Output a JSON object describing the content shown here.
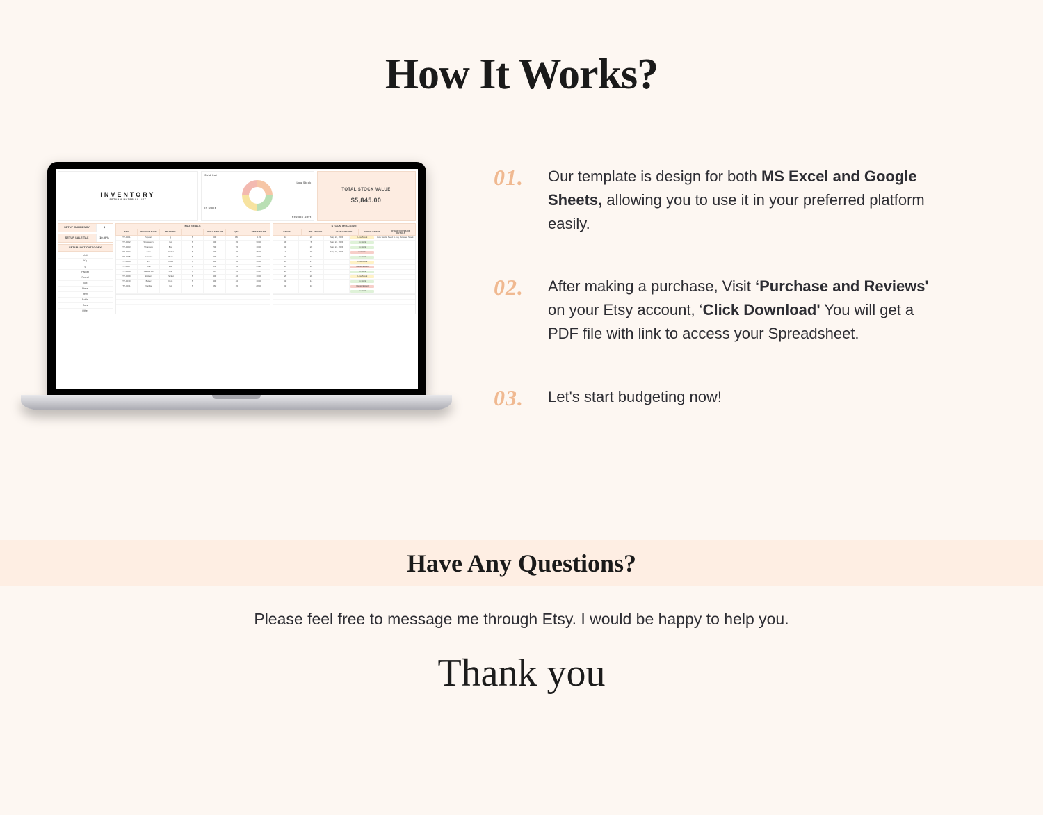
{
  "title": "How It Works?",
  "mockup": {
    "inventory_title": "INVENTORY",
    "inventory_sub": "SETUP & MATERIAL LIST",
    "total_stock_label": "TOTAL STOCK VALUE",
    "total_stock_value": "$5,845.00",
    "chart_labels": {
      "sold_out": "Sold Out",
      "low_stock": "Low Stock",
      "in_stock": "In Stock",
      "restock": "Restock Alert"
    },
    "setup_currency_label": "SETUP CURRENCY",
    "setup_currency_val": "$",
    "setup_tax_label": "SETUP SALE TAX",
    "setup_tax_val": "10.00%",
    "setup_cat_label": "SETUP UNIT CATEGORY",
    "categories": [
      "Unit",
      "Kg",
      "g",
      "Packet",
      "Pound",
      "Box",
      "Piece",
      "Item",
      "Bottle",
      "Cars",
      "Other"
    ],
    "mat_header": "MATERIALS",
    "mat_cols": [
      "SKU",
      "PRODUCT NAME",
      "MEASURE",
      "",
      "TOTAL AMOUNT",
      "QTY",
      "UNIT AMOUNT"
    ],
    "trk_header": "STOCK TRACKING",
    "trk_cols": [
      "STOCK",
      "MIN. STOCKS",
      "LAST CHECKED",
      "STOCK STATUS",
      "OTHER NOTES OR DETAILS"
    ],
    "rows": [
      {
        "sku": "TP-0001",
        "name": "Popcorn",
        "meas": "g",
        "sym": "$",
        "amt": "500",
        "qty": "150",
        "unit": "3.33",
        "stock": "10",
        "min": "20",
        "date": "May 22, 2024",
        "status": "Low Stock",
        "cls": "st-low",
        "note": "Low Stock. Need to buy between Stock"
      },
      {
        "sku": "TP-0002",
        "name": "Strawberry",
        "meas": "Kg",
        "sym": "$",
        "amt": "600",
        "qty": "20",
        "unit": "30.00",
        "stock": "30",
        "min": "5",
        "date": "May 22, 2024",
        "status": "In stock",
        "cls": "st-in",
        "note": ""
      },
      {
        "sku": "TP-0003",
        "name": "Shampoo",
        "meas": "Box",
        "sym": "$",
        "amt": "700",
        "qty": "70",
        "unit": "10.00",
        "stock": "40",
        "min": "20",
        "date": "May 24, 2024",
        "status": "In stock",
        "cls": "st-in",
        "note": ""
      },
      {
        "sku": "TP-0004",
        "name": "Juice",
        "meas": "Packet",
        "sym": "$",
        "amt": "500",
        "qty": "20",
        "unit": "25.00",
        "stock": "0",
        "min": "30",
        "date": "May 22, 2024",
        "status": "Sold Out",
        "cls": "st-out",
        "note": ""
      },
      {
        "sku": "TP-0005",
        "name": "Coconut",
        "meas": "Piece",
        "sym": "$",
        "amt": "200",
        "qty": "10",
        "unit": "20.00",
        "stock": "48",
        "min": "19",
        "date": "",
        "status": "In stock",
        "cls": "st-in",
        "note": ""
      },
      {
        "sku": "TP-0006",
        "name": "Ice",
        "meas": "Piece",
        "sym": "$",
        "amt": "300",
        "qty": "30",
        "unit": "10.00",
        "stock": "10",
        "min": "17",
        "date": "",
        "status": "Low Stock",
        "cls": "st-low",
        "note": ""
      },
      {
        "sku": "TP-0007",
        "name": "Vine",
        "meas": "Box",
        "sym": "$",
        "amt": "556",
        "qty": "10",
        "unit": "55.20",
        "stock": "10",
        "min": "16",
        "date": "",
        "status": "Restock Alert",
        "cls": "st-re",
        "note": ""
      },
      {
        "sku": "TP-0008",
        "name": "Candle 28",
        "meas": "Unit",
        "sym": "$",
        "amt": "633",
        "qty": "20",
        "unit": "31.65",
        "stock": "20",
        "min": "15",
        "date": "",
        "status": "In stock",
        "cls": "st-in",
        "note": ""
      },
      {
        "sku": "TP-0009",
        "name": "Stickers",
        "meas": "Packet",
        "sym": "$",
        "amt": "400",
        "qty": "40",
        "unit": "10.00",
        "stock": "20",
        "min": "28",
        "date": "",
        "status": "Low Stock",
        "cls": "st-low",
        "note": ""
      },
      {
        "sku": "TP-0010",
        "name": "Butter",
        "meas": "Item",
        "sym": "$",
        "amt": "400",
        "qty": "40",
        "unit": "10.00",
        "stock": "40",
        "min": "14",
        "date": "",
        "status": "In stock",
        "cls": "st-in",
        "note": ""
      },
      {
        "sku": "TP-0011",
        "name": "Vanilla",
        "meas": "Kg",
        "sym": "$",
        "amt": "560",
        "qty": "20",
        "unit": "28.00",
        "stock": "40",
        "min": "10",
        "date": "",
        "status": "Restock Alert",
        "cls": "st-re",
        "note": ""
      },
      {
        "sku": "",
        "name": "",
        "meas": "",
        "sym": "",
        "amt": "",
        "qty": "",
        "unit": "",
        "stock": "",
        "min": "",
        "date": "",
        "status": "In stock",
        "cls": "st-in",
        "note": ""
      }
    ]
  },
  "steps": [
    {
      "num": "01.",
      "pre": "Our template is design  for both ",
      "bold": "MS Excel and Google Sheets,",
      "post": " allowing you to use it in your preferred platform easily."
    },
    {
      "num": "02.",
      "pre": "After making a purchase, Visit ",
      "bold": "‘Purchase and Reviews'",
      "mid": " on your Etsy account, ‘",
      "bold2": "Click Download'",
      "post": " You will get a PDF file with link to access your Spreadsheet."
    },
    {
      "num": "03.",
      "pre": "Let's start budgeting now!",
      "bold": "",
      "post": ""
    }
  ],
  "questions_title": "Have Any Questions?",
  "footer_msg": "Please feel free to message me through Etsy. I would be happy to help you.",
  "thanks": "Thank you"
}
